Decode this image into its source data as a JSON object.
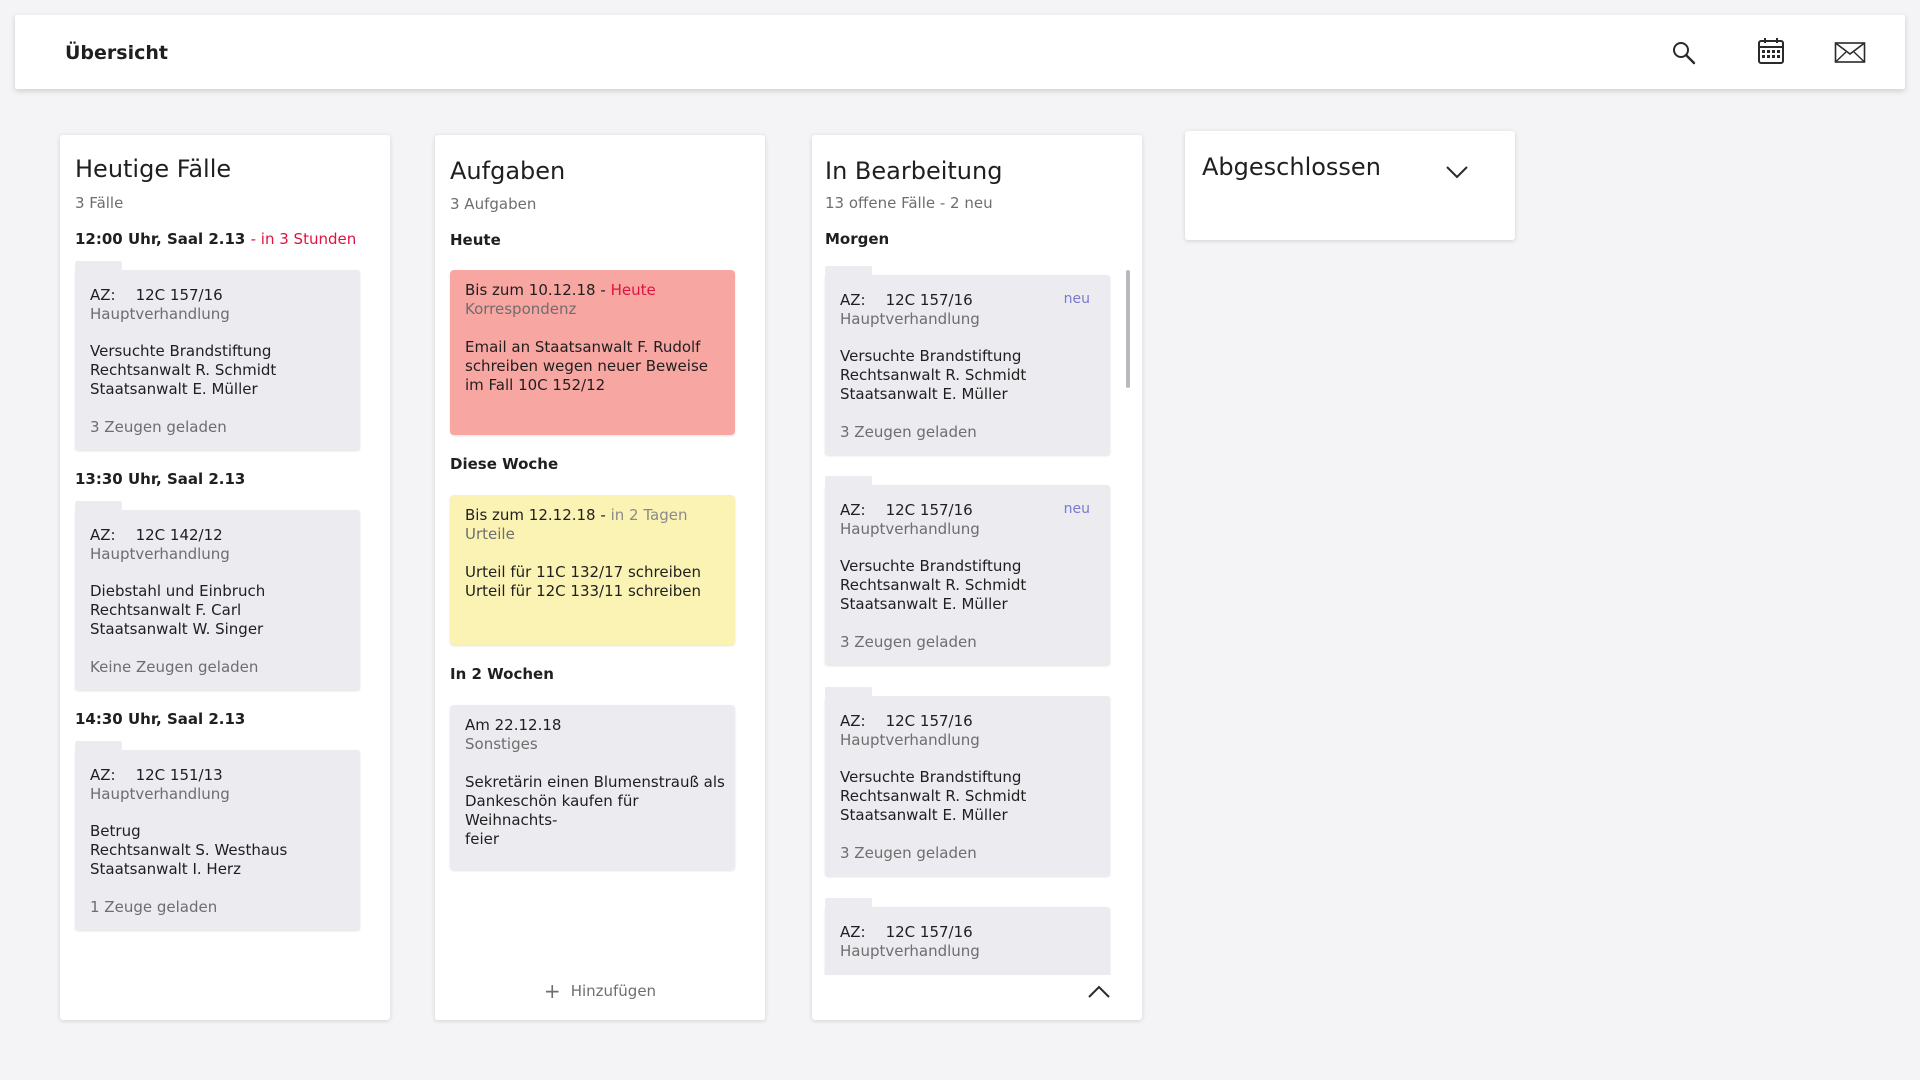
{
  "header": {
    "title": "Übersicht",
    "icons": [
      "search-icon",
      "calendar-icon",
      "mail-icon"
    ]
  },
  "colors": {
    "accent_red": "#e0133f",
    "task_today_bg": "#f7a6a2",
    "task_week_bg": "#fbf3b4",
    "task_other_bg": "#ebebf0",
    "new_badge": "#7a7ad0",
    "card_bg": "#ebebf0"
  },
  "today_cases": {
    "title": "Heutige Fälle",
    "subtitle": "3 Fälle",
    "slots": [
      {
        "time": "12:00 Uhr,  Saal 2.13",
        "relative": "- in 3 Stunden",
        "case": {
          "az_label": "AZ:",
          "az": "12C 157/16",
          "type": "Hauptverhandlung",
          "details": [
            "Versuchte Brandstiftung",
            "Rechtsanwalt R. Schmidt",
            "Staatsanwalt E. Müller"
          ],
          "witnesses": "3 Zeugen geladen"
        }
      },
      {
        "time": "13:30 Uhr,  Saal 2.13",
        "relative": "",
        "case": {
          "az_label": "AZ:",
          "az": "12C 142/12",
          "type": "Hauptverhandlung",
          "details": [
            "Diebstahl und Einbruch",
            "Rechtsanwalt F. Carl",
            "Staatsanwalt W. Singer"
          ],
          "witnesses": "Keine Zeugen geladen"
        }
      },
      {
        "time": "14:30 Uhr,  Saal 2.13",
        "relative": "",
        "case": {
          "az_label": "AZ:",
          "az": "12C 151/13",
          "type": "Hauptverhandlung",
          "details": [
            "Betrug",
            "Rechtsanwalt S. Westhaus",
            "Staatsanwalt I. Herz"
          ],
          "witnesses": "1 Zeuge geladen"
        }
      }
    ]
  },
  "tasks": {
    "title": "Aufgaben",
    "subtitle": "3 Aufgaben",
    "groups": [
      {
        "label": "Heute",
        "task": {
          "due": "Bis zum 10.12.18 -",
          "relative": "Heute",
          "category": "Korrespondenz",
          "body": [
            "Email an Staatsanwalt F. Rudolf",
            "schreiben wegen neuer Beweise",
            "im Fall 10C 152/12"
          ]
        }
      },
      {
        "label": "Diese Woche",
        "task": {
          "due": "Bis zum 12.12.18 -",
          "relative": "in 2 Tagen",
          "category": "Urteile",
          "body": [
            "Urteil für 11C 132/17 schreiben",
            "Urteil für 12C 133/11 schreiben"
          ]
        }
      },
      {
        "label": "In 2 Wochen",
        "task": {
          "due": "Am 22.12.18",
          "relative": "",
          "category": "Sonstiges",
          "body": [
            "Sekretärin einen Blumenstrauß als",
            "Dankeschön kaufen für Weihnachts-",
            "feier"
          ]
        }
      }
    ],
    "add_label": "Hinzufügen"
  },
  "in_progress": {
    "title": "In Bearbeitung",
    "subtitle": "13 offene Fälle - 2 neu",
    "section": "Morgen",
    "cases": [
      {
        "az_label": "AZ:",
        "az": "12C 157/16",
        "type": "Hauptverhandlung",
        "details": [
          "Versuchte Brandstiftung",
          "Rechtsanwalt R. Schmidt",
          "Staatsanwalt E. Müller"
        ],
        "witnesses": "3 Zeugen geladen",
        "badge": "neu"
      },
      {
        "az_label": "AZ:",
        "az": "12C 157/16",
        "type": "Hauptverhandlung",
        "details": [
          "Versuchte Brandstiftung",
          "Rechtsanwalt R. Schmidt",
          "Staatsanwalt E. Müller"
        ],
        "witnesses": "3 Zeugen geladen",
        "badge": "neu"
      },
      {
        "az_label": "AZ:",
        "az": "12C 157/16",
        "type": "Hauptverhandlung",
        "details": [
          "Versuchte Brandstiftung",
          "Rechtsanwalt R. Schmidt",
          "Staatsanwalt E. Müller"
        ],
        "witnesses": "3 Zeugen geladen",
        "badge": ""
      },
      {
        "az_label": "AZ:",
        "az": "12C 157/16",
        "type": "Hauptverhandlung",
        "details": [],
        "witnesses": "",
        "badge": ""
      }
    ]
  },
  "completed": {
    "title": "Abgeschlossen"
  }
}
